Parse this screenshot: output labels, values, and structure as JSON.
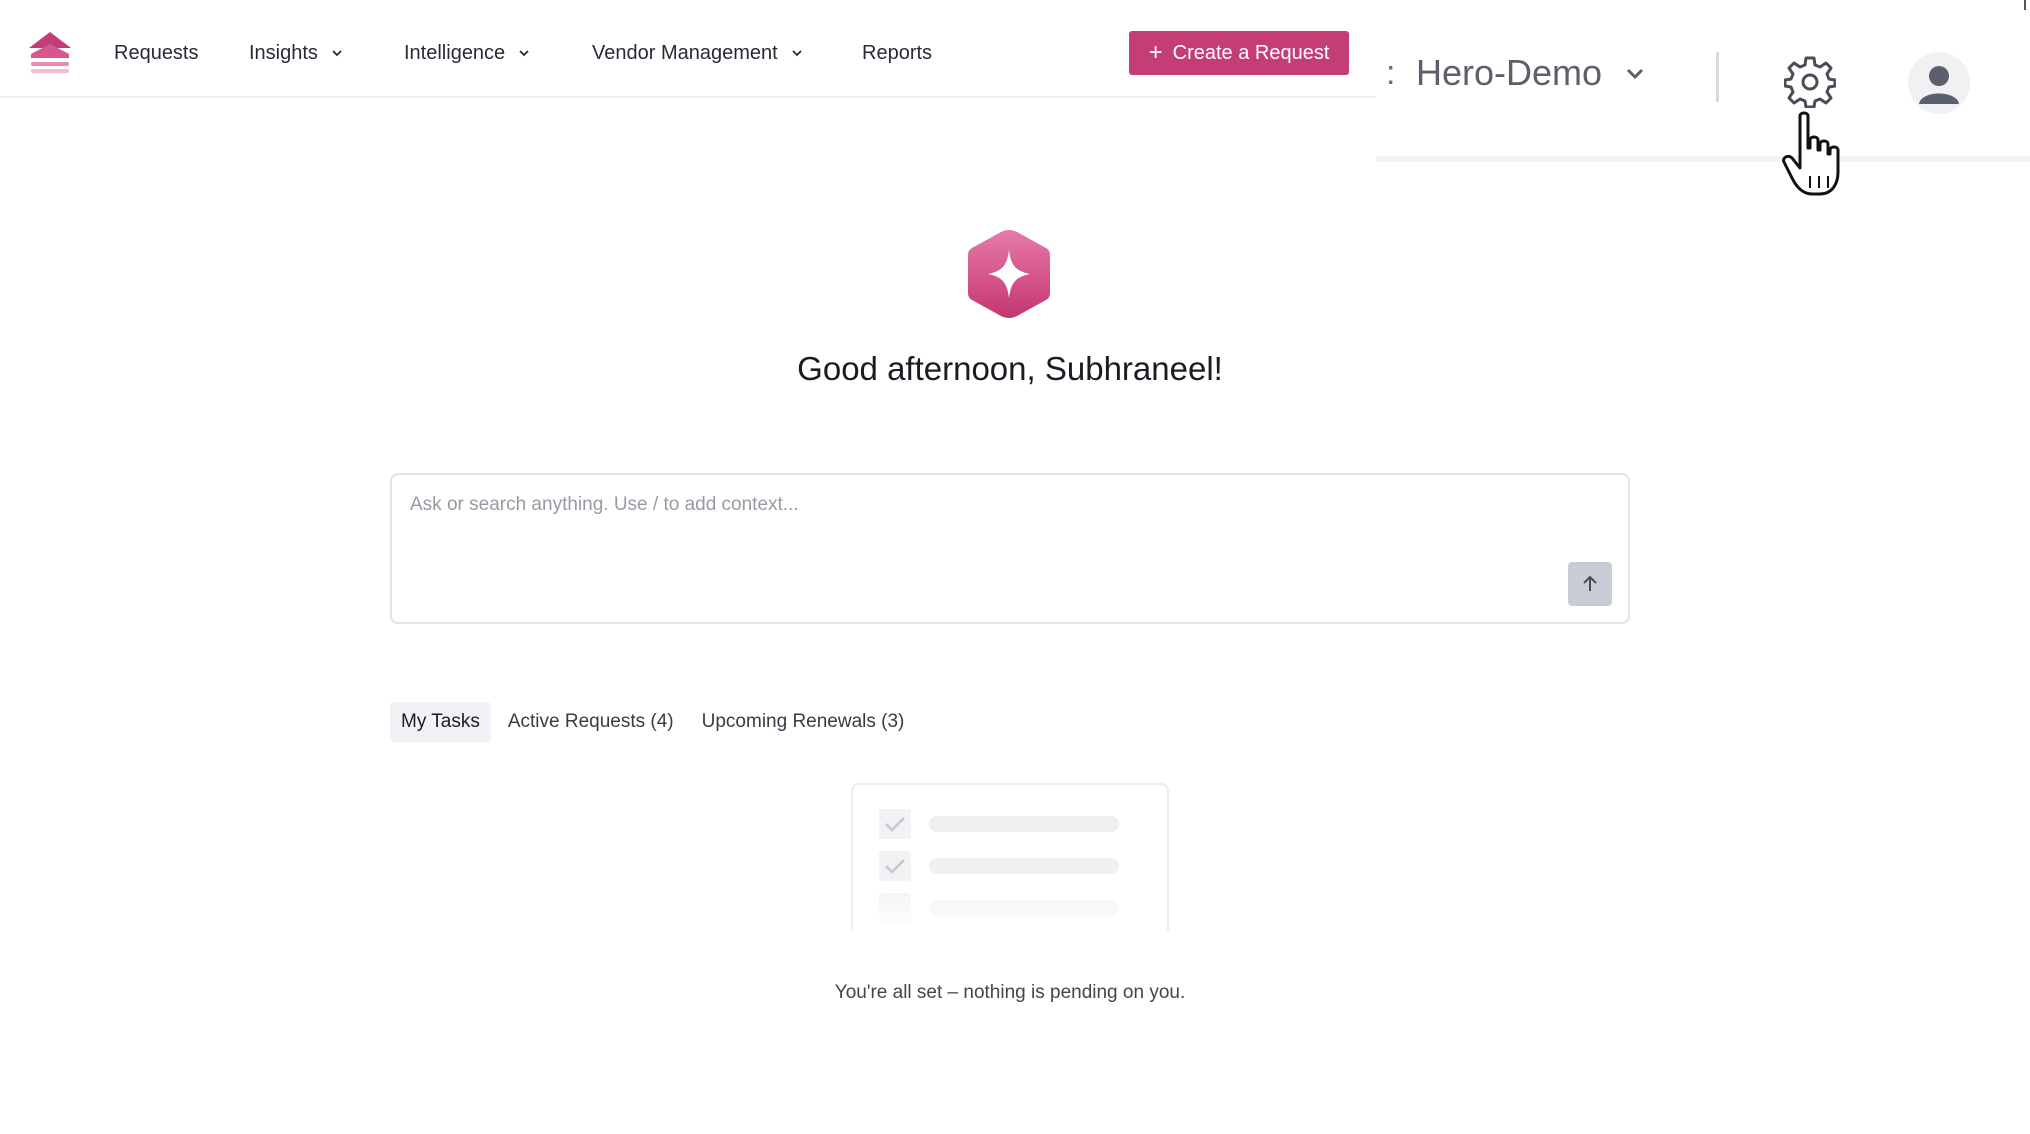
{
  "nav": {
    "items": [
      {
        "label": "Requests",
        "has_dropdown": false
      },
      {
        "label": "Insights",
        "has_dropdown": true
      },
      {
        "label": "Intelligence",
        "has_dropdown": true
      },
      {
        "label": "Vendor Management",
        "has_dropdown": true
      },
      {
        "label": "Reports",
        "has_dropdown": false
      }
    ],
    "create_button": {
      "icon": "+",
      "label": "Create a Request"
    }
  },
  "header_right": {
    "separator": ":",
    "workspace": "Hero-Demo",
    "settings_icon": "gear-icon",
    "avatar_icon": "user-icon"
  },
  "hero": {
    "greeting": "Good afternoon, Subhraneel!"
  },
  "ask": {
    "placeholder": "Ask or search anything. Use / to add context...",
    "value": ""
  },
  "tabs": [
    {
      "label": "My Tasks",
      "active": true
    },
    {
      "label": "Active Requests (4)",
      "active": false
    },
    {
      "label": "Upcoming Renewals (3)",
      "active": false
    }
  ],
  "empty_state": {
    "message": "You're all set – nothing is pending on you."
  },
  "colors": {
    "brand": "#c43d77",
    "send_button": "#c9ccd4"
  }
}
